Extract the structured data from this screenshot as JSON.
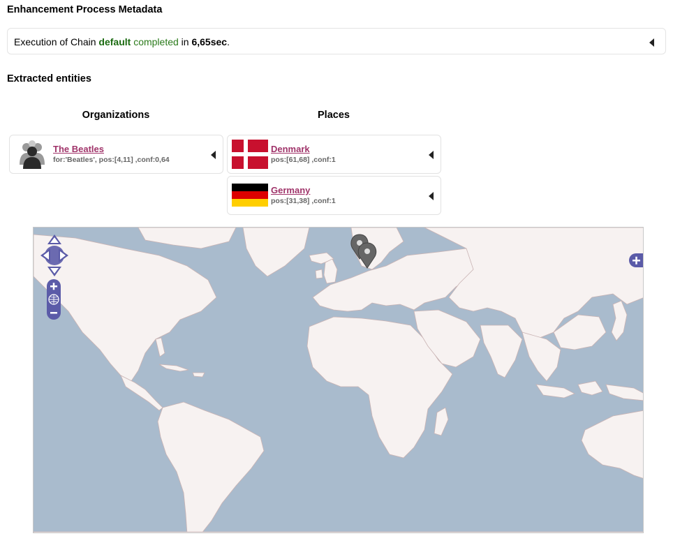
{
  "meta_section": {
    "title": "Enhancement Process Metadata",
    "prefix": "Execution of Chain ",
    "chain_name": "default",
    "status": "completed",
    "in_word": " in ",
    "duration": "6,65sec",
    "suffix": "."
  },
  "entities_section": {
    "title": "Extracted entities",
    "organizations": {
      "heading": "Organizations",
      "items": [
        {
          "name": "The Beatles",
          "meta": "for:'Beatles', pos:[4,11] ,conf:0,64",
          "icon": "person-silhouette-icon"
        }
      ]
    },
    "places": {
      "heading": "Places",
      "items": [
        {
          "name": "Denmark",
          "meta": "pos:[61,68] ,conf:1",
          "icon": "denmark-flag-icon"
        },
        {
          "name": "Germany",
          "meta": "pos:[31,38] ,conf:1",
          "icon": "germany-flag-icon"
        }
      ]
    }
  },
  "map": {
    "colors": {
      "water": "#a9bbcd",
      "land": "#f7f2f1",
      "border": "#c9b3b3",
      "control": "#5b5ba8"
    },
    "markers": [
      "Denmark",
      "Germany"
    ]
  }
}
